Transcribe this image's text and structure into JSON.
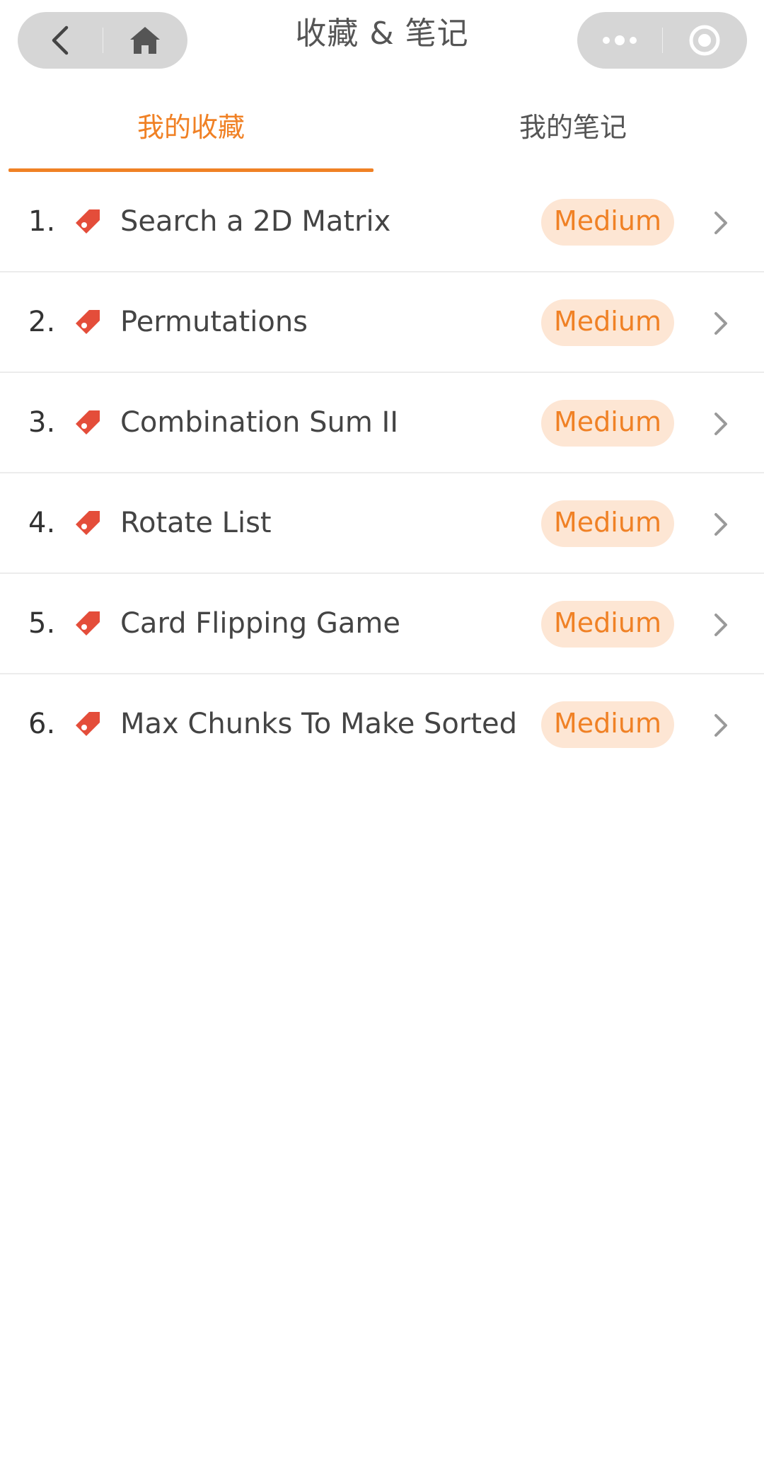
{
  "navbar": {
    "title": "收藏 & 笔记",
    "back_icon": "back-arrow-icon",
    "home_icon": "home-icon",
    "more_icon": "more-dots-icon",
    "close_icon": "capsule-close-icon"
  },
  "tabs": [
    {
      "label": "我的收藏",
      "active": true
    },
    {
      "label": "我的笔记",
      "active": false
    }
  ],
  "colors": {
    "accent": "#f08125",
    "badge_bg": "#fde6d4",
    "tag_icon": "#e44d3a",
    "capsule_bg": "#d6d6d6"
  },
  "favorites": [
    {
      "number": "1.",
      "title": "Search a 2D Matrix",
      "difficulty": "Medium"
    },
    {
      "number": "2.",
      "title": "Permutations",
      "difficulty": "Medium"
    },
    {
      "number": "3.",
      "title": "Combination Sum II",
      "difficulty": "Medium"
    },
    {
      "number": "4.",
      "title": "Rotate List",
      "difficulty": "Medium"
    },
    {
      "number": "5.",
      "title": "Card Flipping Game",
      "difficulty": "Medium"
    },
    {
      "number": "6.",
      "title": "Max Chunks To Make Sorted",
      "difficulty": "Medium"
    }
  ]
}
